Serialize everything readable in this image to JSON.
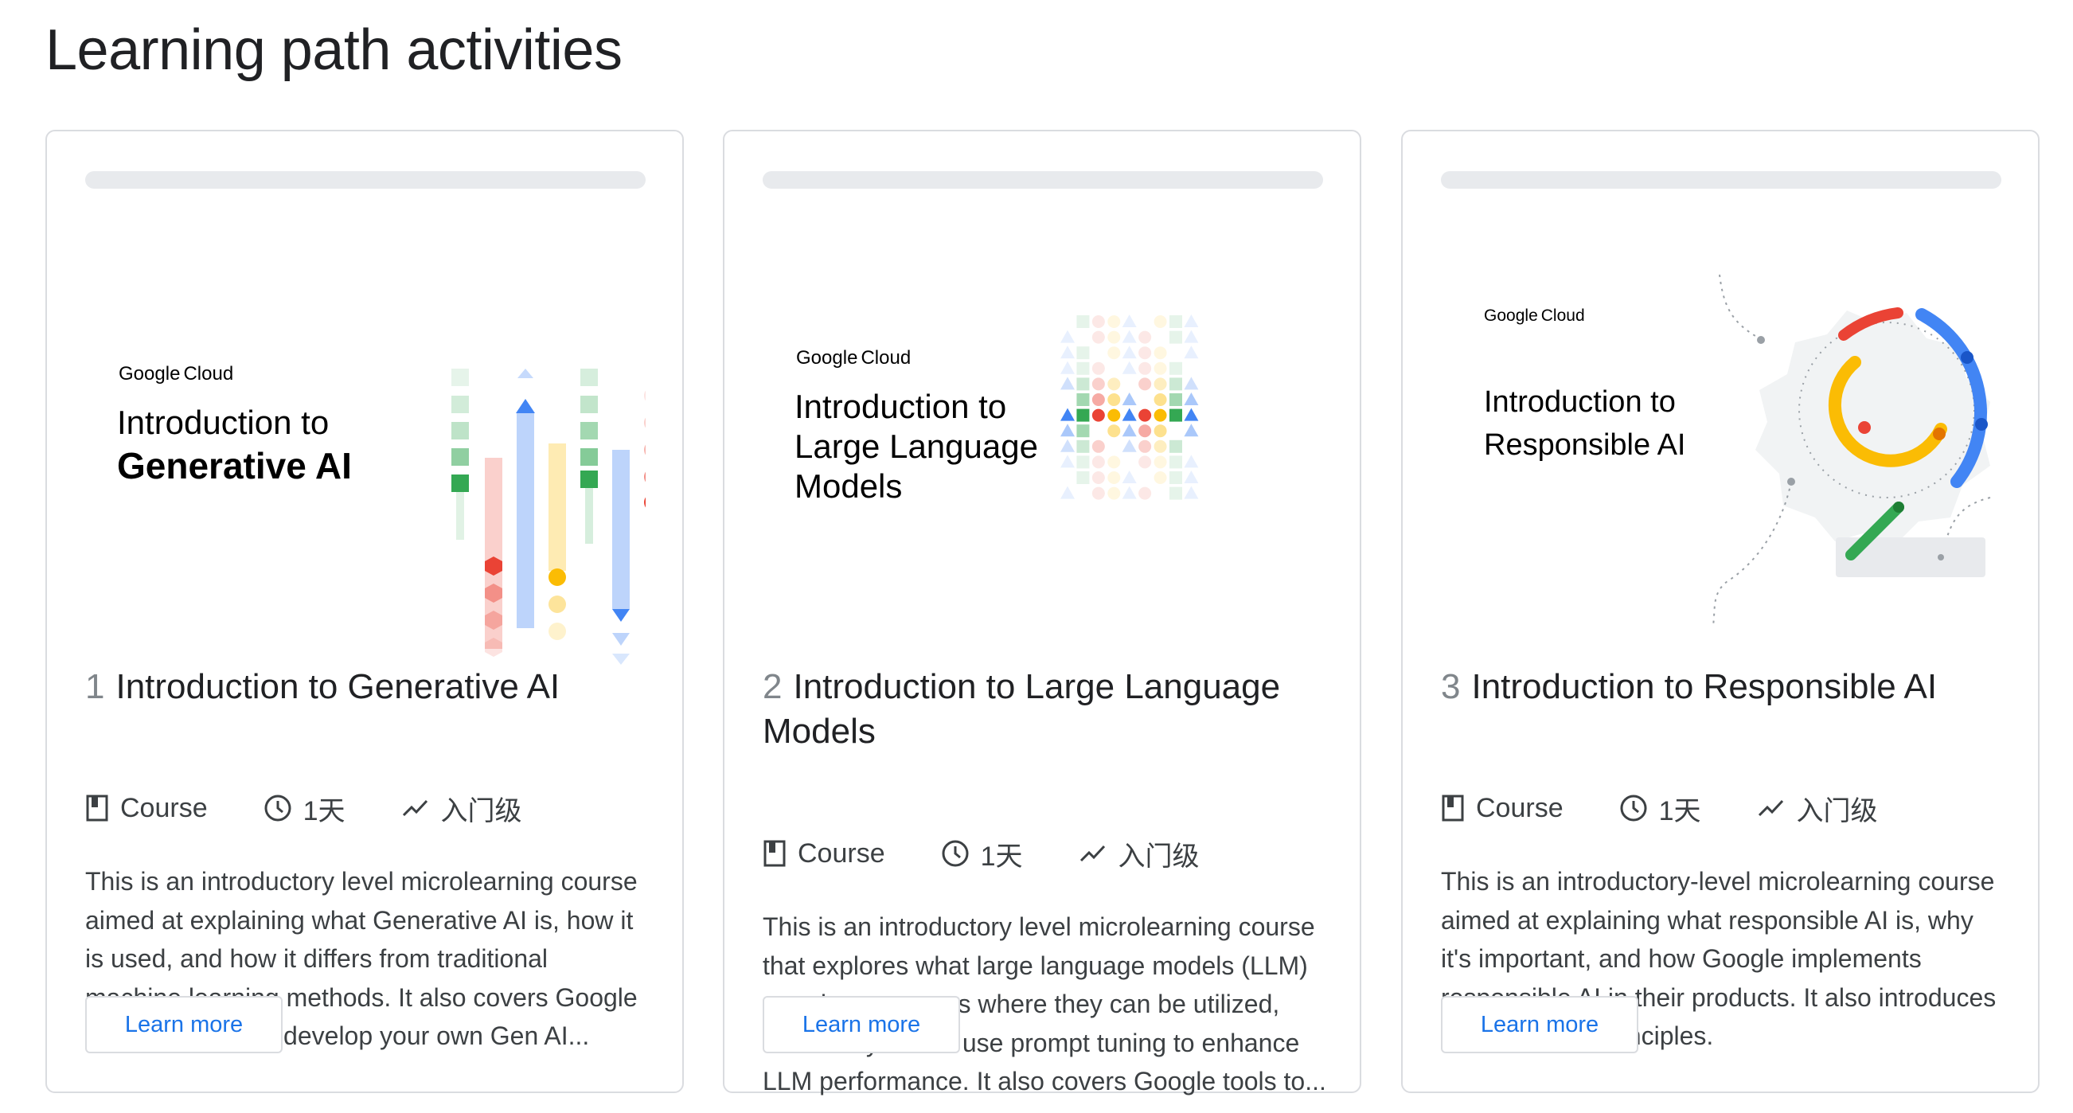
{
  "page": {
    "title": "Learning path activities"
  },
  "brand": {
    "google": [
      "G",
      "o",
      "o",
      "g",
      "l",
      "e"
    ],
    "cloud": "Cloud"
  },
  "cards": [
    {
      "number": "1",
      "title": "Introduction to Generative AI",
      "thumb_title_lines": [
        "Introduction to",
        "Generative AI"
      ],
      "type": "Course",
      "duration": "1天",
      "level": "入门级",
      "description": "This is an introductory level microlearning course aimed at explaining what Generative AI is, how it is used, and how it differs from traditional machine learning methods. It also covers Google Tools to help you develop your own Gen AI...",
      "button": "Learn more"
    },
    {
      "number": "2",
      "title": "Introduction to Large Language Models",
      "thumb_title_lines": [
        "Introduction to",
        "Large Language",
        "Models"
      ],
      "type": "Course",
      "duration": "1天",
      "level": "入门级",
      "description": "This is an introductory level microlearning course that explores what large language models (LLM) are, the use cases where they can be utilized, and how you can use prompt tuning to enhance LLM performance. It also covers Google tools to...",
      "button": "Learn more"
    },
    {
      "number": "3",
      "title": "Introduction to Responsible AI",
      "thumb_title_lines": [
        "Introduction to",
        "Responsible AI"
      ],
      "type": "Course",
      "duration": "1天",
      "level": "入门级",
      "description": "This is an introductory-level microlearning course aimed at explaining what responsible AI is, why it's important, and how Google implements responsible AI in their products. It also introduces Google's 7 AI principles.",
      "button": "Learn more"
    }
  ],
  "colors": {
    "blue": "#4285f4",
    "red": "#ea4335",
    "yellow": "#fbbc04",
    "green": "#34a853",
    "link": "#1a73e8",
    "border": "#dadce0"
  }
}
